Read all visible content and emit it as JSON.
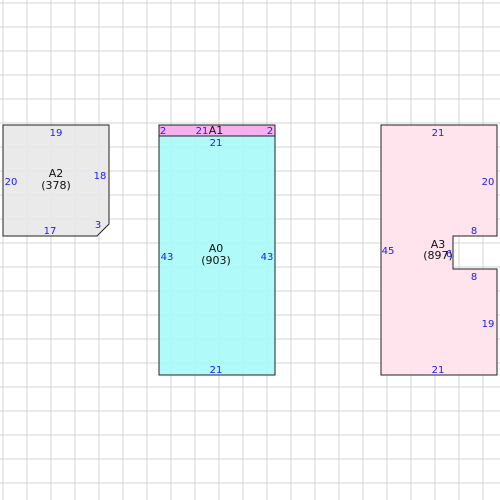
{
  "colors": {
    "grid": "#d4d4d4",
    "dimension_text": "#1a1aff",
    "label_text": "#111111",
    "outline": "#222222"
  },
  "shapes": [
    {
      "id": "A2",
      "name": "A2",
      "area": "(378)",
      "fill": "#e8e8e8",
      "dims": [
        "19",
        "20",
        "18",
        "17",
        "3"
      ]
    },
    {
      "id": "A1",
      "name": "A1",
      "area": "",
      "fill": "#f7a8ee",
      "dims": [
        "2",
        "21",
        "2"
      ]
    },
    {
      "id": "A0",
      "name": "A0",
      "area": "(903)",
      "fill": "#aafafa",
      "dims": [
        "21",
        "43",
        "43",
        "21"
      ]
    },
    {
      "id": "A3",
      "name": "A3",
      "area": "(897)",
      "fill": "#ffe1ec",
      "dims": [
        "21",
        "20",
        "45",
        "8",
        "6",
        "8",
        "19",
        "21"
      ]
    }
  ]
}
